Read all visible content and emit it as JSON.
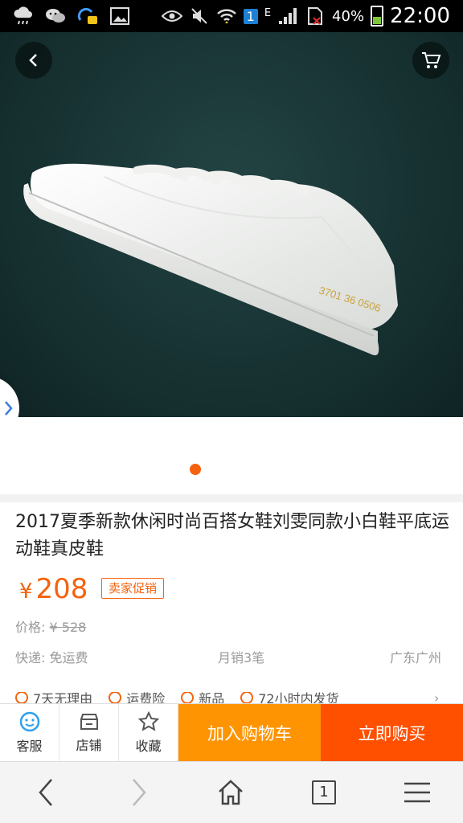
{
  "status_bar": {
    "battery_percent": "40%",
    "time": "22:00",
    "network_indicator": "E",
    "sim_badge": "1"
  },
  "hero": {
    "image_description_icon": "white-sneaker-photo",
    "shoe_code": "3701 36 0506",
    "active_slide": 1
  },
  "product": {
    "title": "2017夏季新款休闲时尚百搭女鞋刘雯同款小白鞋平底运动鞋真皮鞋",
    "currency": "¥",
    "price": "208",
    "promo_badge": "卖家促销",
    "orig_label": "价格:",
    "orig_price": "¥ 528",
    "shipping": "快递: 免运费",
    "monthly_sales": "月销3笔",
    "location": "广东广州",
    "services": [
      "7天无理由",
      "运费险",
      "新品",
      "72小时内发货"
    ]
  },
  "actions": {
    "service_label": "客服",
    "shop_label": "店铺",
    "fav_label": "收藏",
    "add_cart_label": "加入购物车",
    "buy_now_label": "立即购买"
  },
  "browser_nav": {
    "tab_count": "1"
  },
  "colors": {
    "accent": "#f5620e",
    "cart_button": "#ff9402",
    "buy_button": "#ff5000"
  }
}
